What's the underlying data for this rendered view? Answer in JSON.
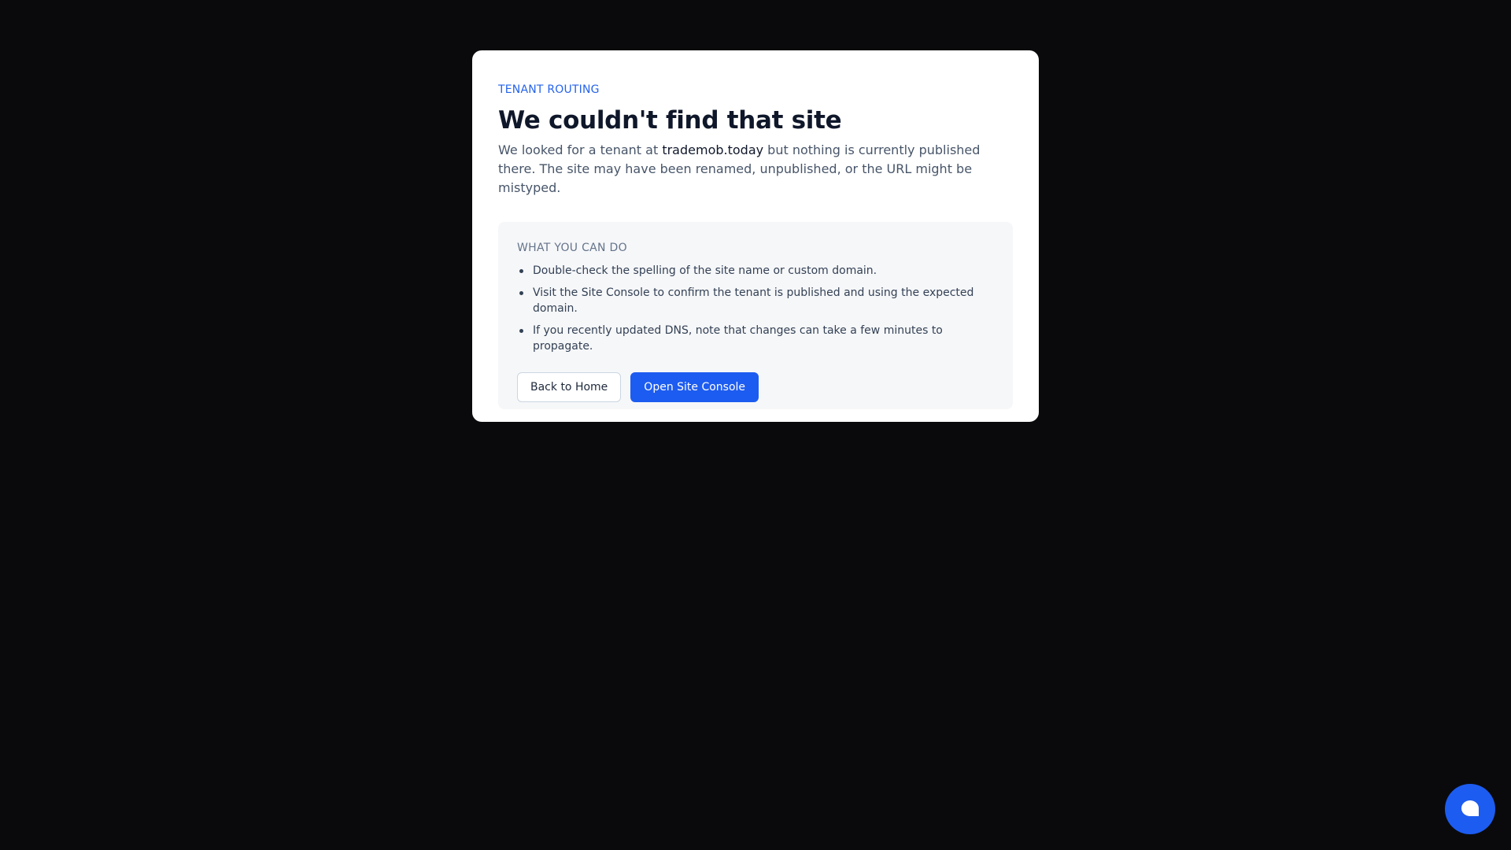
{
  "card": {
    "eyebrow": "TENANT ROUTING",
    "title": "We couldn't find that site",
    "description_prefix": "We looked for a tenant at ",
    "domain": "trademob.today",
    "description_suffix": " but nothing is currently published there. The site may have been renamed, unpublished, or the URL might be mistyped."
  },
  "panel": {
    "heading": "WHAT YOU CAN DO",
    "tips": [
      "Double-check the spelling of the site name or custom domain.",
      "Visit the Site Console to confirm the tenant is published and using the expected domain.",
      "If you recently updated DNS, note that changes can take a few minutes to propagate."
    ],
    "buttons": {
      "back_label": "Back to Home",
      "console_label": "Open Site Console"
    }
  },
  "chat": {
    "icon": "chat-bubble-icon"
  },
  "colors": {
    "background": "#0a0a0d",
    "accent": "#1d5cf0",
    "eyebrow": "#2563eb",
    "panel": "#f6f7f9"
  }
}
